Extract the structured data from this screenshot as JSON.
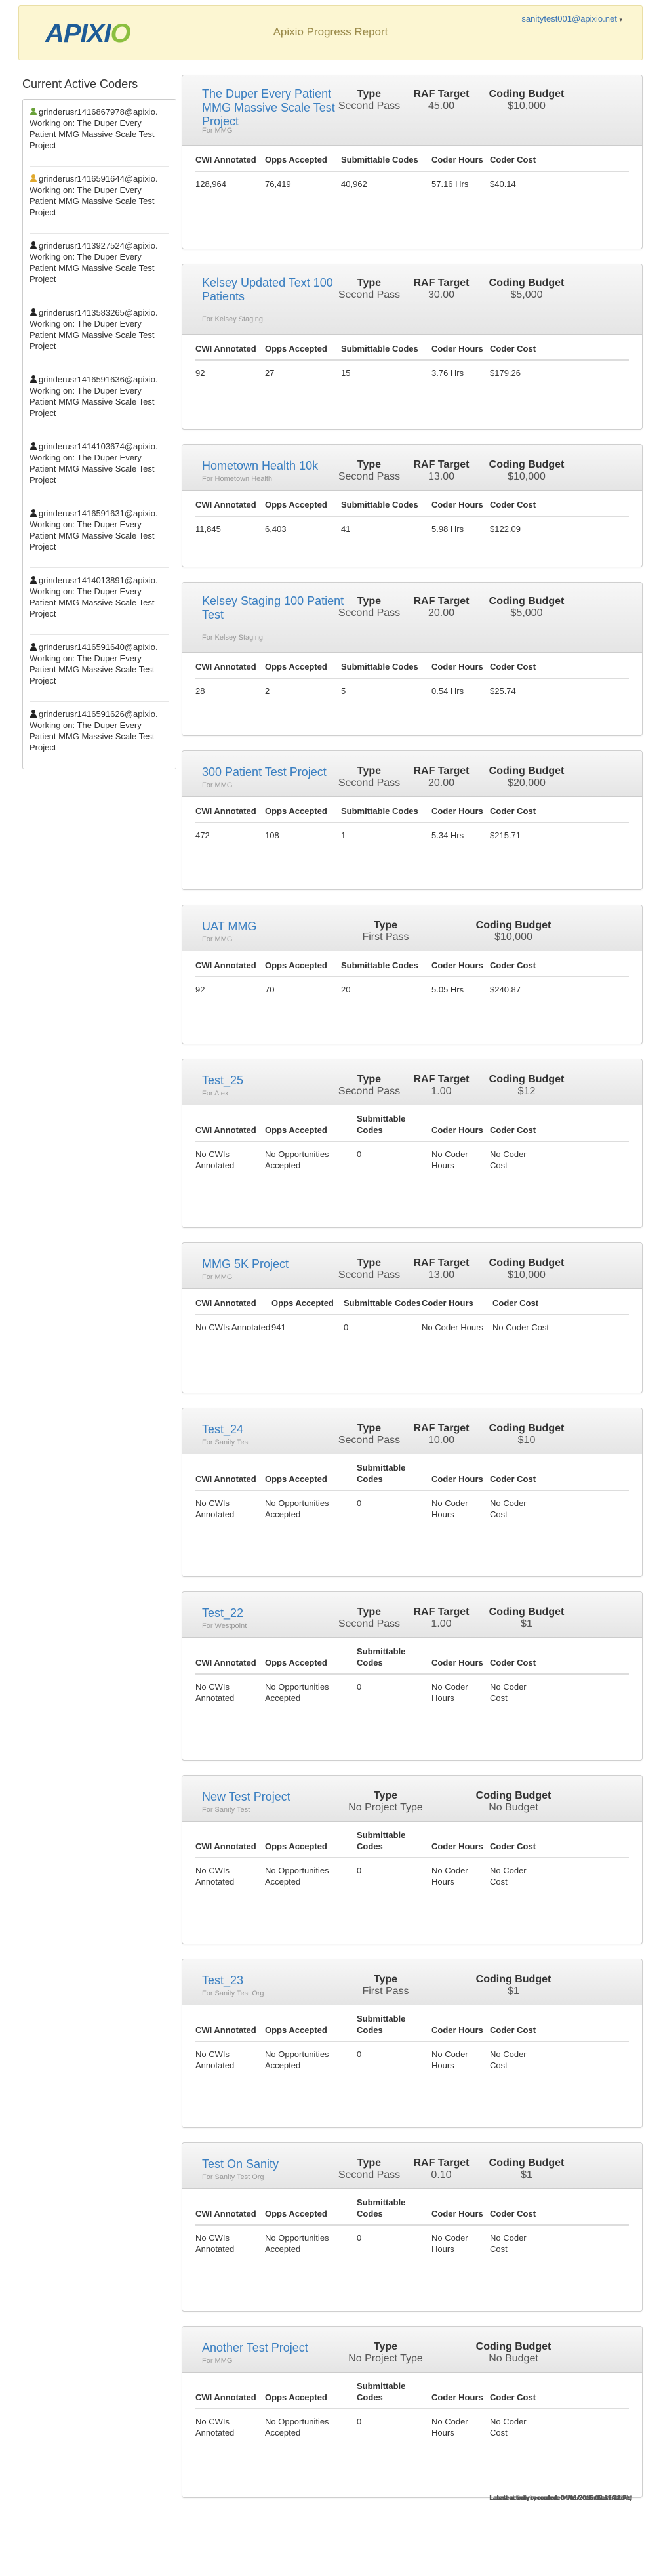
{
  "header": {
    "logo_main": "APIXI",
    "logo_accent": "O",
    "title": "Apixio Progress Report",
    "user_email": "sanitytest001@apixio.net",
    "caret": "▾"
  },
  "sidebar": {
    "heading": "Current Active Coders",
    "coders": [
      {
        "name": "grinderusr1416867978@apixio.",
        "working": "Working on: The Duper Every Patient MMG Massive Scale Test Project",
        "icon_color": "#6aa23a"
      },
      {
        "name": "grinderusr1416591644@apixio.",
        "working": "Working on: The Duper Every Patient MMG Massive Scale Test Project",
        "icon_color": "#e0a92e"
      },
      {
        "name": "grinderusr1413927524@apixio.",
        "working": "Working on: The Duper Every Patient MMG Massive Scale Test Project",
        "icon_color": "#222222"
      },
      {
        "name": "grinderusr1413583265@apixio.",
        "working": "Working on: The Duper Every Patient MMG Massive Scale Test Project",
        "icon_color": "#222222"
      },
      {
        "name": "grinderusr1416591636@apixio.",
        "working": "Working on: The Duper Every Patient MMG Massive Scale Test Project",
        "icon_color": "#222222"
      },
      {
        "name": "grinderusr1414103674@apixio.",
        "working": "Working on: The Duper Every Patient MMG Massive Scale Test Project",
        "icon_color": "#222222"
      },
      {
        "name": "grinderusr1416591631@apixio.",
        "working": "Working on: The Duper Every Patient MMG Massive Scale Test Project",
        "icon_color": "#222222"
      },
      {
        "name": "grinderusr1414013891@apixio.",
        "working": "Working on: The Duper Every Patient MMG Massive Scale Test Project",
        "icon_color": "#222222"
      },
      {
        "name": "grinderusr1416591640@apixio.",
        "working": "Working on: The Duper Every Patient MMG Massive Scale Test Project",
        "icon_color": "#222222"
      },
      {
        "name": "grinderusr1416591626@apixio.",
        "working": "Working on: The Duper Every Patient MMG Massive Scale Test Project",
        "icon_color": "#222222"
      }
    ]
  },
  "labels": {
    "type": "Type",
    "raf_target": "RAF Target",
    "coding_budget": "Coding Budget",
    "cwi_annotated": "CWI Annotated",
    "opps_accepted": "Opps Accepted",
    "submittable_codes": "Submittable Codes",
    "coder_hours": "Coder Hours",
    "coder_cost": "Coder Cost",
    "latest_activity_prefix": "Latest activity recorded: "
  },
  "projects": [
    {
      "name": "The Duper Every Patient MMG Massive Scale Test Project",
      "org": "For MMG",
      "type": "Second Pass",
      "raf": "45.00",
      "budget": "$10,000",
      "cwi": "128,964",
      "opps": "76,419",
      "codes": "40,962",
      "hours": "57.16 Hrs",
      "cost": "$40.14",
      "activity": "04/14/2015 12:14:54 AM"
    },
    {
      "name": "Kelsey Updated Text 100 Patients",
      "org": "For Kelsey Staging",
      "type": "Second Pass",
      "raf": "30.00",
      "budget": "$5,000",
      "cwi": "92",
      "opps": "27",
      "codes": "15",
      "hours": "3.76 Hrs",
      "cost": "$179.26",
      "activity": "04/13/2015 09:51:51 PM"
    },
    {
      "name": "Hometown Health 10k",
      "org": "For Hometown Health",
      "type": "Second Pass",
      "raf": "13.00",
      "budget": "$10,000",
      "cwi": "11,845",
      "opps": "6,403",
      "codes": "41",
      "hours": "5.98 Hrs",
      "cost": "$122.09",
      "activity": "04/11/2015 04:39:47 AM"
    },
    {
      "name": "Kelsey Staging 100 Patient Test",
      "org": "For Kelsey Staging",
      "type": "Second Pass",
      "raf": "20.00",
      "budget": "$5,000",
      "cwi": "28",
      "opps": "2",
      "codes": "5",
      "hours": "0.54 Hrs",
      "cost": "$25.74",
      "activity": "04/08/2015 10:23:42 PM"
    },
    {
      "name": "300 Patient Test Project",
      "org": "For MMG",
      "type": "Second Pass",
      "raf": "20.00",
      "budget": "$20,000",
      "cwi": "472",
      "opps": "108",
      "codes": "1",
      "hours": "5.34 Hrs",
      "cost": "$215.71",
      "activity": "04/06/2015 05:29:28 PM"
    },
    {
      "name": "UAT MMG",
      "org": "For MMG",
      "type": "First Pass",
      "raf": "",
      "budget": "$10,000",
      "cwi": "92",
      "opps": "70",
      "codes": "20",
      "hours": "5.05 Hrs",
      "cost": "$240.87",
      "activity": "04/04/2015 12:27:26 AM"
    },
    {
      "name": "Test_25",
      "org": "For Alex",
      "type": "Second Pass",
      "raf": "1.00",
      "budget": "$12",
      "cwi": "No CWIs Annotated",
      "opps": "No Opportunities Accepted",
      "codes": "0",
      "hours": "No Coder Hours",
      "cost": "No Coder Cost",
      "activity": "No Coder Last Activity"
    },
    {
      "name": "MMG 5K Project",
      "org": "For MMG",
      "type": "Second Pass",
      "raf": "13.00",
      "budget": "$10,000",
      "cwi": "No CWIs Annotated",
      "opps": "941",
      "codes": "0",
      "hours": "No Coder Hours",
      "cost": "No Coder Cost",
      "activity": "No Coder Last Activity"
    },
    {
      "name": "Test_24",
      "org": "For Sanity Test",
      "type": "Second Pass",
      "raf": "10.00",
      "budget": "$10",
      "cwi": "No CWIs Annotated",
      "opps": "No Opportunities Accepted",
      "codes": "0",
      "hours": "No Coder Hours",
      "cost": "No Coder Cost",
      "activity": "No Coder Last Activity"
    },
    {
      "name": "Test_22",
      "org": "For Westpoint",
      "type": "Second Pass",
      "raf": "1.00",
      "budget": "$1",
      "cwi": "No CWIs Annotated",
      "opps": "No Opportunities Accepted",
      "codes": "0",
      "hours": "No Coder Hours",
      "cost": "No Coder Cost",
      "activity": "No Coder Last Activity"
    },
    {
      "name": "New Test Project",
      "org": "For Sanity Test",
      "type": "No Project Type",
      "raf": "",
      "budget": "No Budget",
      "cwi": "No CWIs Annotated",
      "opps": "No Opportunities Accepted",
      "codes": "0",
      "hours": "No Coder Hours",
      "cost": "No Coder Cost",
      "activity": "No Coder Last Activity"
    },
    {
      "name": "Test_23",
      "org": "For Sanity Test Org",
      "type": "First Pass",
      "raf": "",
      "budget": "$1",
      "cwi": "No CWIs Annotated",
      "opps": "No Opportunities Accepted",
      "codes": "0",
      "hours": "No Coder Hours",
      "cost": "No Coder Cost",
      "activity": "No Coder Last Activity"
    },
    {
      "name": "Test On Sanity",
      "org": "For Sanity Test Org",
      "type": "Second Pass",
      "raf": "0.10",
      "budget": "$1",
      "cwi": "No CWIs Annotated",
      "opps": "No Opportunities Accepted",
      "codes": "0",
      "hours": "No Coder Hours",
      "cost": "No Coder Cost",
      "activity": "No Coder Last Activity"
    },
    {
      "name": "Another Test Project",
      "org": "For MMG",
      "type": "No Project Type",
      "raf": "",
      "budget": "No Budget",
      "cwi": "No CWIs Annotated",
      "opps": "No Opportunities Accepted",
      "codes": "0",
      "hours": "No Coder Hours",
      "cost": "No Coder Cost",
      "activity": "No Coder Last Activity"
    }
  ]
}
